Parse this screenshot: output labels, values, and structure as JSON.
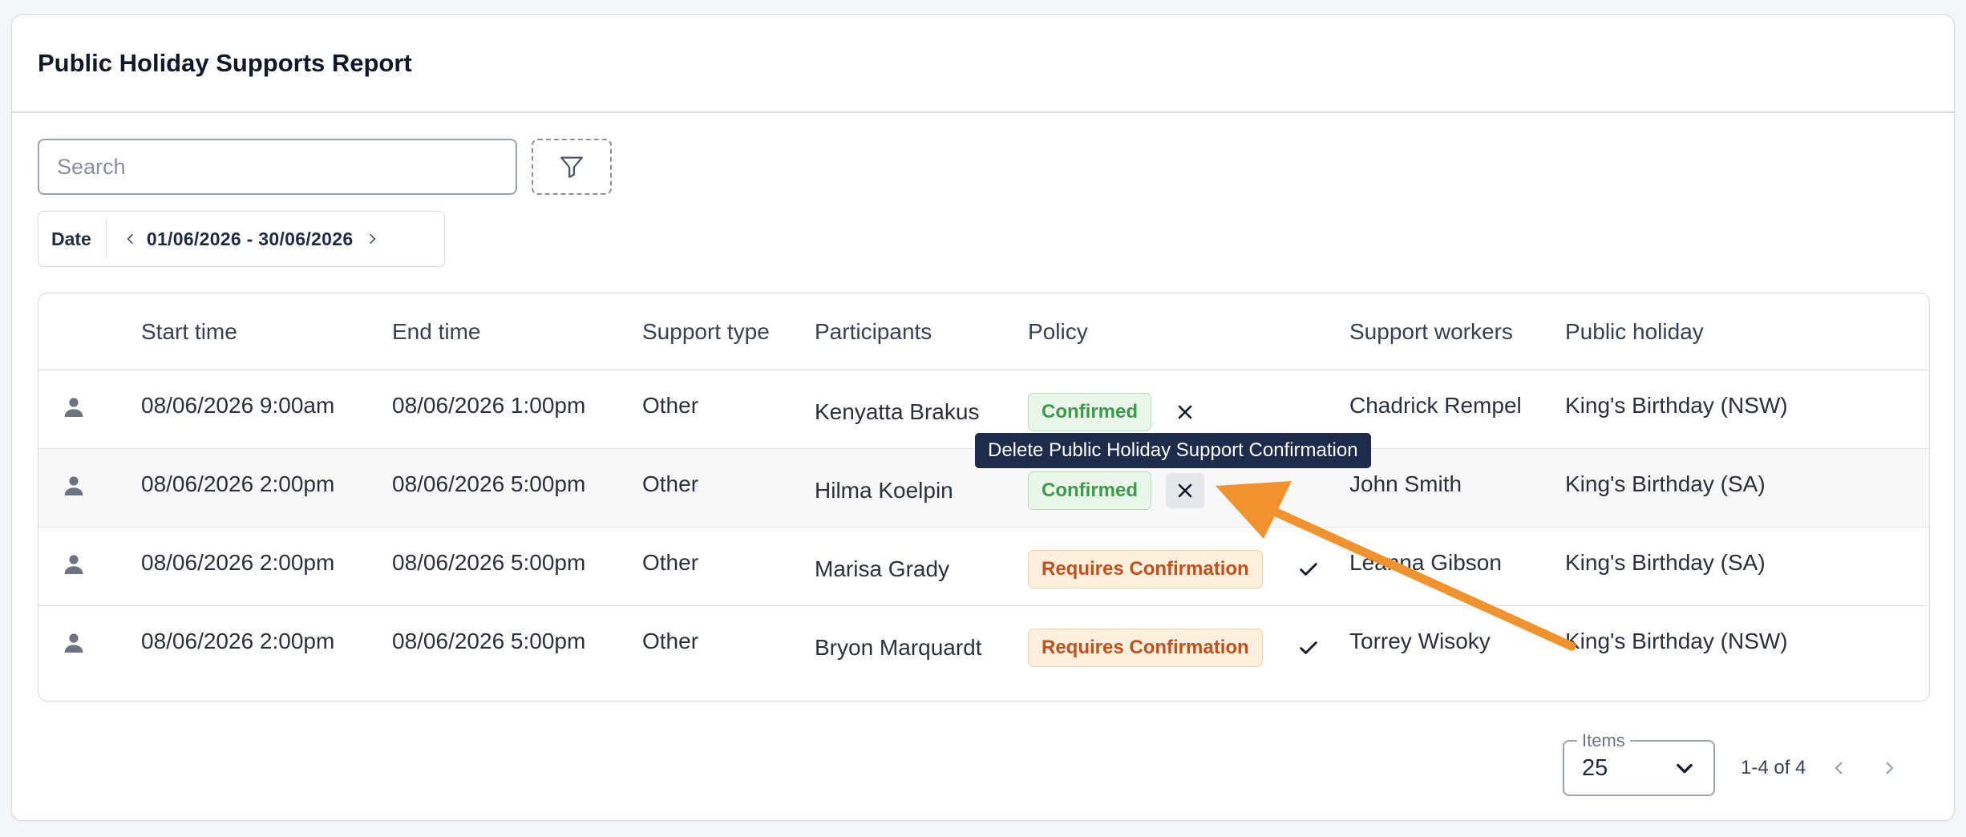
{
  "header": {
    "title": "Public Holiday Supports Report"
  },
  "search": {
    "placeholder": "Search",
    "value": ""
  },
  "filter": {
    "icon": "filter-icon"
  },
  "date_filter": {
    "label": "Date",
    "range": "01/06/2026 - 30/06/2026"
  },
  "table": {
    "columns": [
      "Start time",
      "End time",
      "Support type",
      "Participants",
      "Policy",
      "Support workers",
      "Public holiday"
    ],
    "rows": [
      {
        "start": "08/06/2026 9:00am",
        "end": "08/06/2026 1:00pm",
        "type": "Other",
        "participant": "Kenyatta Brakus",
        "policy": "Confirmed",
        "action": "close-icon",
        "worker": "Chadrick Rempel",
        "holiday": "King's Birthday (NSW)"
      },
      {
        "start": "08/06/2026 2:00pm",
        "end": "08/06/2026 5:00pm",
        "type": "Other",
        "participant": "Hilma Koelpin",
        "policy": "Confirmed",
        "action": "close-icon",
        "worker": "John Smith",
        "holiday": "King's Birthday (SA)"
      },
      {
        "start": "08/06/2026 2:00pm",
        "end": "08/06/2026 5:00pm",
        "type": "Other",
        "participant": "Marisa Grady",
        "policy": "Requires Confirmation",
        "action": "check-icon",
        "worker": "Leanna Gibson",
        "holiday": "King's Birthday (SA)"
      },
      {
        "start": "08/06/2026 2:00pm",
        "end": "08/06/2026 5:00pm",
        "type": "Other",
        "participant": "Bryon Marquardt",
        "policy": "Requires Confirmation",
        "action": "check-icon",
        "worker": "Torrey Wisoky",
        "holiday": "King's Birthday (NSW)"
      }
    ]
  },
  "tooltip": {
    "text": "Delete Public Holiday Support Confirmation"
  },
  "pagination": {
    "items_label": "Items",
    "items_value": "25",
    "range": "1-4 of 4"
  },
  "colors": {
    "confirmed_bg": "#eaf6ea",
    "confirmed_text": "#3c9a4a",
    "requires_bg": "#fff0dd",
    "requires_text": "#c2501a",
    "tooltip_bg": "#1e2b4a",
    "annotation_arrow": "#f0922e"
  }
}
